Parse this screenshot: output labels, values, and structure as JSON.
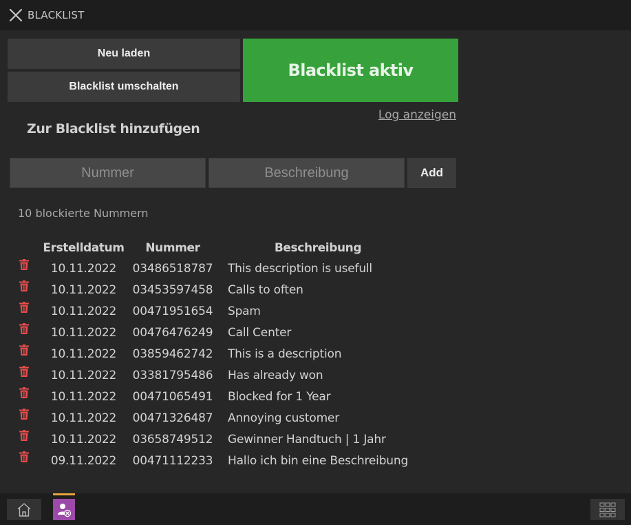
{
  "header": {
    "title": "BLACKLIST",
    "close_icon": "close-icon"
  },
  "controls": {
    "reload_label": "Neu laden",
    "toggle_label": "Blacklist umschalten",
    "status_label": "Blacklist aktiv",
    "status_color": "#37a23b",
    "log_link": "Log anzeigen"
  },
  "add_form": {
    "heading": "Zur Blacklist hinzufügen",
    "number_placeholder": "Nummer",
    "description_placeholder": "Beschreibung",
    "add_label": "Add"
  },
  "list": {
    "count_text": "10 blockierte Nummern",
    "columns": {
      "date": "Erstelldatum",
      "number": "Nummer",
      "description": "Beschreibung"
    },
    "delete_icon": "trash-icon",
    "delete_color": "#e74c4c",
    "rows": [
      {
        "date": "10.11.2022",
        "number": "03486518787",
        "description": "This description is usefull"
      },
      {
        "date": "10.11.2022",
        "number": "03453597458",
        "description": "Calls to often"
      },
      {
        "date": "10.11.2022",
        "number": "00471951654",
        "description": "Spam"
      },
      {
        "date": "10.11.2022",
        "number": "00476476249",
        "description": "Call Center"
      },
      {
        "date": "10.11.2022",
        "number": "03859462742",
        "description": "This is a description"
      },
      {
        "date": "10.11.2022",
        "number": "03381795486",
        "description": "Has already won"
      },
      {
        "date": "10.11.2022",
        "number": "00471065491",
        "description": "Blocked for 1 Year"
      },
      {
        "date": "10.11.2022",
        "number": "00471326487",
        "description": "Annoying customer"
      },
      {
        "date": "10.11.2022",
        "number": "03658749512",
        "description": "Gewinner Handtuch | 1 Jahr"
      },
      {
        "date": "09.11.2022",
        "number": "00471112233",
        "description": "Hallo ich bin eine Beschreibung"
      }
    ]
  },
  "bottom_nav": {
    "home_icon": "home-icon",
    "user_block_icon": "user-block-icon",
    "apps_grid_icon": "apps-grid-icon",
    "active_indicator_color": "#e8a33c"
  }
}
